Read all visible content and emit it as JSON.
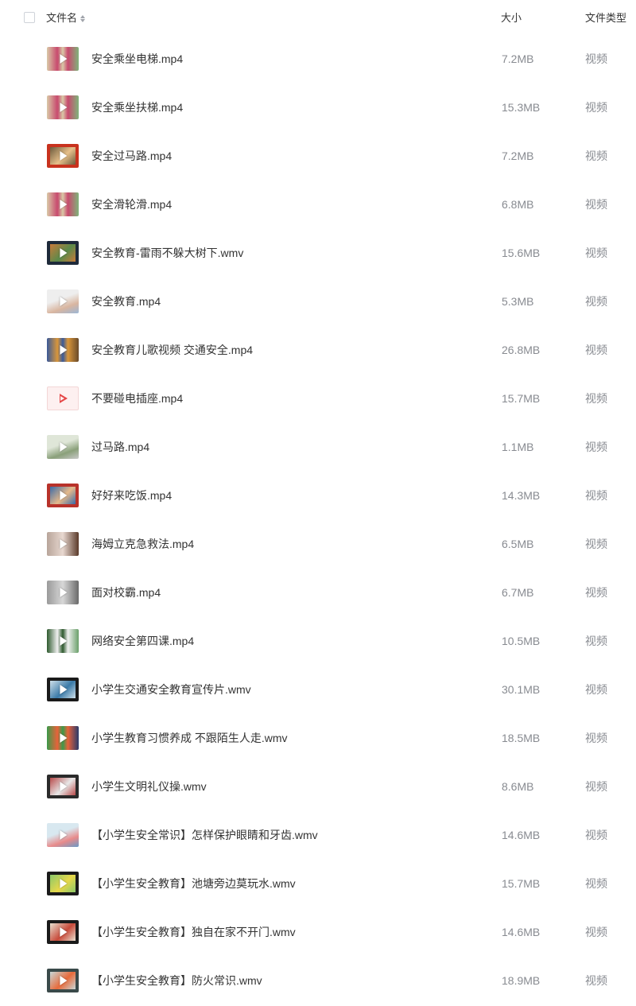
{
  "header": {
    "name_label": "文件名",
    "size_label": "大小",
    "type_label": "文件类型"
  },
  "files": [
    {
      "name": "安全乘坐电梯.mp4",
      "size": "7.2MB",
      "type": "视频",
      "thumb_style": "cartoon",
      "colors": [
        "#d9c9a7",
        "#c84a6e",
        "#7fb37a"
      ]
    },
    {
      "name": "安全乘坐扶梯.mp4",
      "size": "15.3MB",
      "type": "视频",
      "thumb_style": "cartoon",
      "colors": [
        "#d9c9a7",
        "#c84a6e",
        "#7fb37a"
      ]
    },
    {
      "name": "安全过马路.mp4",
      "size": "7.2MB",
      "type": "视频",
      "thumb_style": "framed",
      "colors": [
        "#c8321e",
        "#6b5a3c",
        "#e7c08a"
      ]
    },
    {
      "name": "安全滑轮滑.mp4",
      "size": "6.8MB",
      "type": "视频",
      "thumb_style": "cartoon",
      "colors": [
        "#d9c9a7",
        "#c84a6e",
        "#7fb37a"
      ]
    },
    {
      "name": "安全教育-雷雨不躲大树下.wmv",
      "size": "15.6MB",
      "type": "视频",
      "thumb_style": "framed",
      "colors": [
        "#1e2a3a",
        "#c87a3a",
        "#5a8a4a"
      ]
    },
    {
      "name": "安全教育.mp4",
      "size": "5.3MB",
      "type": "视频",
      "thumb_style": "light",
      "colors": [
        "#eeeeee",
        "#d9b6a0",
        "#9cb7d6"
      ]
    },
    {
      "name": "安全教育儿歌视频 交通安全.mp4",
      "size": "26.8MB",
      "type": "视频",
      "thumb_style": "cartoon",
      "colors": [
        "#3a5a9a",
        "#d9963a",
        "#6a4a2a"
      ]
    },
    {
      "name": "不要碰电插座.mp4",
      "size": "15.7MB",
      "type": "视频",
      "thumb_style": "plain",
      "colors": [
        "#fdf0f0",
        "#e54545",
        "#f3d6d6"
      ]
    },
    {
      "name": "过马路.mp4",
      "size": "1.1MB",
      "type": "视频",
      "thumb_style": "light",
      "colors": [
        "#dfe6d8",
        "#8aa07a",
        "#c9c9c9"
      ]
    },
    {
      "name": "好好来吃饭.mp4",
      "size": "14.3MB",
      "type": "视频",
      "thumb_style": "framed",
      "colors": [
        "#b8322a",
        "#3a6aa8",
        "#e6b98a"
      ]
    },
    {
      "name": "海姆立克急救法.mp4",
      "size": "6.5MB",
      "type": "视频",
      "thumb_style": "photo",
      "colors": [
        "#b8a59a",
        "#e8d8d0",
        "#5a3a2a"
      ]
    },
    {
      "name": "面对校霸.mp4",
      "size": "6.7MB",
      "type": "视频",
      "thumb_style": "photo",
      "colors": [
        "#9a9a9a",
        "#d8d8d8",
        "#6a6a6a"
      ]
    },
    {
      "name": "网络安全第四课.mp4",
      "size": "10.5MB",
      "type": "视频",
      "thumb_style": "cartoon",
      "colors": [
        "#2e5a2e",
        "#f0f0f0",
        "#6aa06a"
      ]
    },
    {
      "name": "小学生交通安全教育宣传片.wmv",
      "size": "30.1MB",
      "type": "视频",
      "thumb_style": "framed",
      "colors": [
        "#1a1a1a",
        "#cfe0ea",
        "#3a7aa8"
      ]
    },
    {
      "name": "小学生教育习惯养成  不跟陌生人走.wmv",
      "size": "18.5MB",
      "type": "视频",
      "thumb_style": "cartoon",
      "colors": [
        "#3a9a4a",
        "#e8623a",
        "#2a3a6a"
      ]
    },
    {
      "name": "小学生文明礼仪操.wmv",
      "size": "8.6MB",
      "type": "视频",
      "thumb_style": "framed",
      "colors": [
        "#2a2a2a",
        "#b84a4a",
        "#e8e8e8"
      ]
    },
    {
      "name": "【小学生安全常识】怎样保护眼睛和牙齿.wmv",
      "size": "14.6MB",
      "type": "视频",
      "thumb_style": "light",
      "colors": [
        "#d8e8f0",
        "#e88a8a",
        "#6a9ac8"
      ]
    },
    {
      "name": "【小学生安全教育】池塘旁边莫玩水.wmv",
      "size": "15.7MB",
      "type": "视频",
      "thumb_style": "framed",
      "colors": [
        "#1a1a1a",
        "#8ac86a",
        "#e8d84a"
      ]
    },
    {
      "name": "【小学生安全教育】独自在家不开门.wmv",
      "size": "14.6MB",
      "type": "视频",
      "thumb_style": "framed",
      "colors": [
        "#1a1a1a",
        "#e8e0d0",
        "#c84a3a"
      ]
    },
    {
      "name": "【小学生安全教育】防火常识.wmv",
      "size": "18.9MB",
      "type": "视频",
      "thumb_style": "framed",
      "colors": [
        "#3a4a4a",
        "#c8d8d8",
        "#e86a3a"
      ]
    }
  ]
}
